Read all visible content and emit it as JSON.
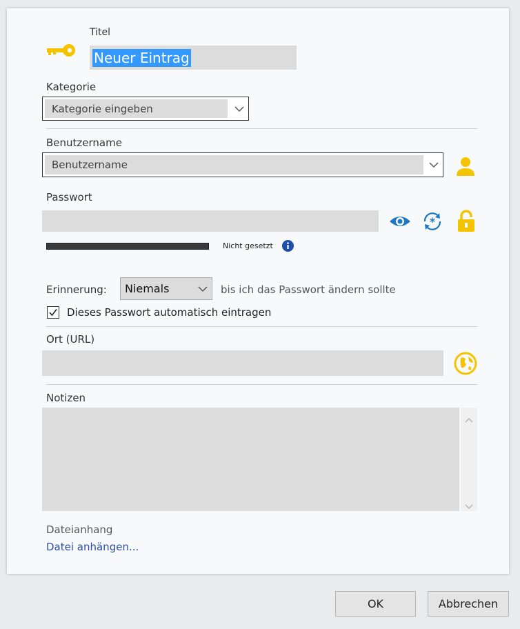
{
  "title": {
    "label": "Titel",
    "value": "Neuer Eintrag"
  },
  "category": {
    "label": "Kategorie",
    "placeholder": "Kategorie eingeben"
  },
  "username": {
    "label": "Benutzername",
    "placeholder": "Benutzername"
  },
  "password": {
    "label": "Passwort",
    "value": "",
    "strength_text": "Nicht gesetzt"
  },
  "reminder": {
    "label": "Erinnerung:",
    "selected": "Niemals",
    "suffix": "bis ich das Passwort ändern sollte"
  },
  "autofill": {
    "label": "Dieses Passwort automatisch eintragen",
    "checked": true
  },
  "url": {
    "label": "Ort (URL)",
    "value": ""
  },
  "notes": {
    "label": "Notizen",
    "value": ""
  },
  "attachment": {
    "label": "Dateianhang",
    "link": "Datei anhängen..."
  },
  "buttons": {
    "ok": "OK",
    "cancel": "Abbrechen"
  },
  "colors": {
    "accent_yellow": "#f5c400",
    "accent_blue": "#1f78c1",
    "selection_blue": "#3399ff",
    "info_blue": "#1f4fa8"
  }
}
